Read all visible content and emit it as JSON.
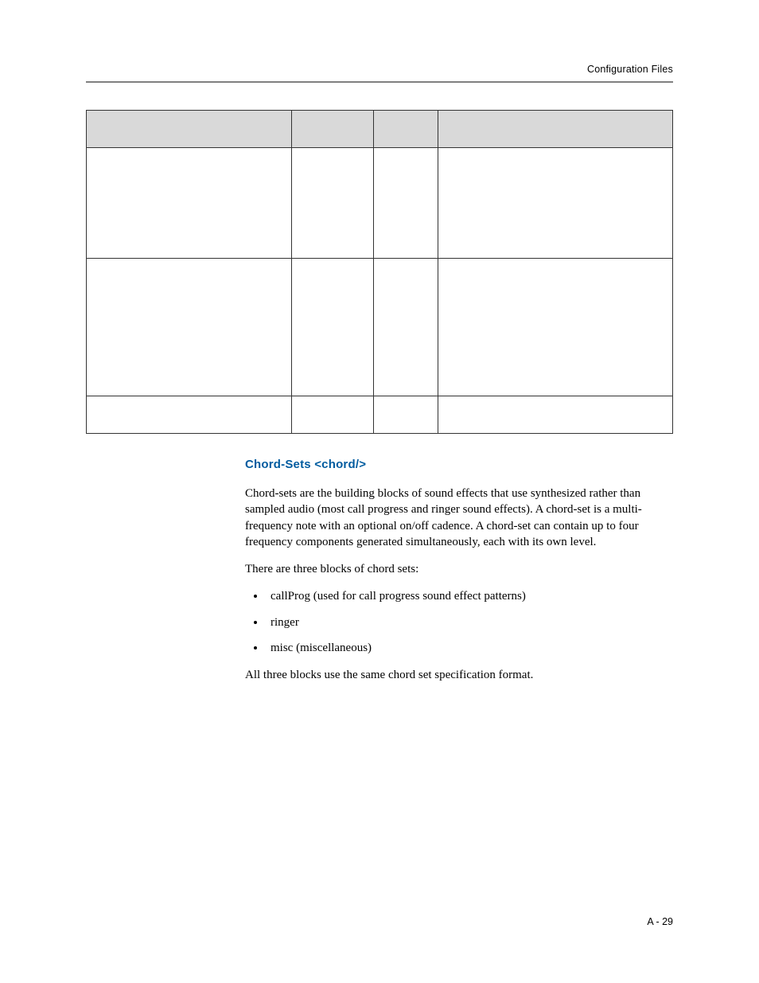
{
  "running_head": "Configuration Files",
  "table": {
    "headers": [
      "",
      "",
      "",
      ""
    ],
    "rows": [
      [
        "",
        "",
        "",
        ""
      ],
      [
        "",
        "",
        "",
        ""
      ],
      [
        "",
        "",
        "",
        ""
      ]
    ]
  },
  "section_title": "Chord-Sets <chord/>",
  "para1": "Chord-sets are the building blocks of sound effects that use synthesized rather than sampled audio (most call progress and ringer sound effects). A chord-set is a multi-frequency note with an optional on/off cadence. A chord-set can contain up to four frequency components generated simultaneously, each with its own level.",
  "para2": "There are three blocks of chord sets:",
  "bullets": [
    "callProg (used for call progress sound effect patterns)",
    "ringer",
    "misc (miscellaneous)"
  ],
  "para3": "All three blocks use the same chord set specification format.",
  "folio": "A - 29"
}
